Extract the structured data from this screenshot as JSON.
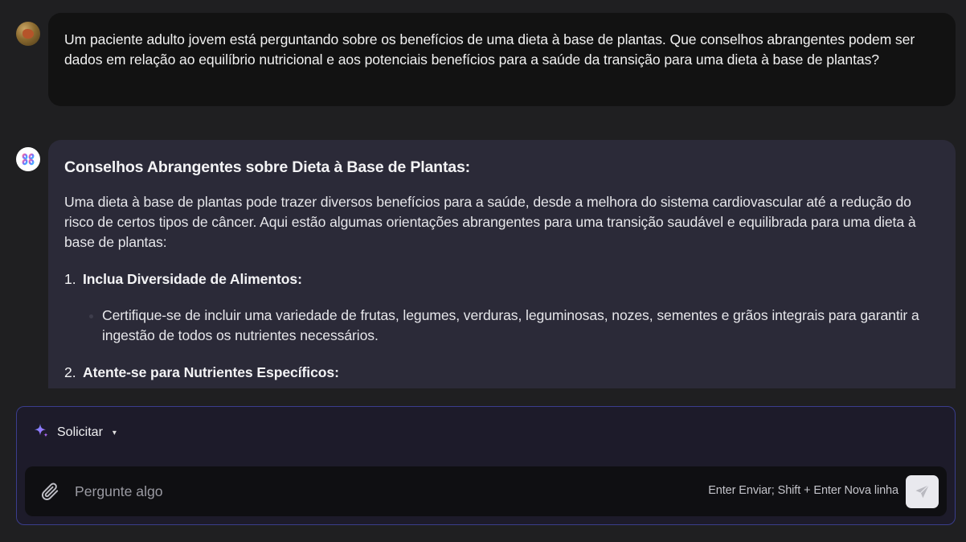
{
  "conversation": {
    "user_message": {
      "avatar": "user-avatar-photo",
      "text": "Um paciente adulto jovem está perguntando sobre os benefícios de uma dieta à base de plantas. Que conselhos abrangentes podem ser dados em relação ao equilíbrio nutricional e aos potenciais benefícios para a saúde da transição para uma dieta à base de plantas?"
    },
    "assistant_message": {
      "avatar": "assistant-logo-icon",
      "title": "Conselhos Abrangentes sobre Dieta à Base de Plantas:",
      "intro": "Uma dieta à base de plantas pode trazer diversos benefícios para a saúde, desde a melhora do sistema cardiovascular até a redução do risco de certos tipos de câncer. Aqui estão algumas orientações abrangentes para uma transição saudável e equilibrada para uma dieta à base de plantas:",
      "items": [
        {
          "number": "1.",
          "label": "Inclua Diversidade de Alimentos:",
          "bullets": [
            "Certifique-se de incluir uma variedade de frutas, legumes, verduras, leguminosas, nozes, sementes e grãos integrais para garantir a ingestão de todos os nutrientes necessários."
          ]
        },
        {
          "number": "2.",
          "label": "Atente-se para Nutrientes Específicos:",
          "bullets": []
        }
      ]
    }
  },
  "composer": {
    "mode_icon": "sparkle-icon",
    "mode_label": "Solicitar",
    "mode_caret": "▾",
    "input_placeholder": "Pergunte algo",
    "input_value": "",
    "hint": "Enter Enviar; Shift + Enter Nova linha",
    "attach_icon": "paperclip-icon",
    "send_icon": "send-icon"
  },
  "colors": {
    "background": "#1f1f21",
    "user_bubble": "#121212",
    "assistant_bubble": "#2b2a38",
    "composer_border": "#3a3d8c",
    "sparkle_gradient_start": "#6a8cff",
    "sparkle_gradient_end": "#b36cff"
  }
}
